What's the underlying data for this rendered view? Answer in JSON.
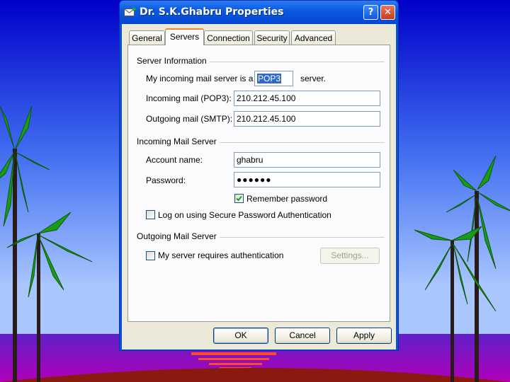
{
  "window": {
    "title": "Dr. S.K.Ghabru Properties",
    "help_label": "?",
    "close_label": "✕"
  },
  "tabs": [
    {
      "label": "General",
      "active": false
    },
    {
      "label": "Servers",
      "active": true
    },
    {
      "label": "Connection",
      "active": false
    },
    {
      "label": "Security",
      "active": false
    },
    {
      "label": "Advanced",
      "active": false
    }
  ],
  "server_info": {
    "group_label": "Server Information",
    "incoming_type_prefix": "My incoming mail server is a",
    "incoming_type_value": "POP3",
    "incoming_type_suffix": "server.",
    "incoming_label": "Incoming mail (POP3):",
    "incoming_value": "210.212.45.100",
    "outgoing_label": "Outgoing mail (SMTP):",
    "outgoing_value": "210.212.45.100"
  },
  "incoming_server": {
    "group_label": "Incoming Mail Server",
    "account_label": "Account name:",
    "account_value": "ghabru",
    "password_label": "Password:",
    "password_value": "●●●●●●",
    "remember_label": "Remember password",
    "remember_checked": true,
    "spa_label": "Log on using Secure Password Authentication",
    "spa_checked": false
  },
  "outgoing_server": {
    "group_label": "Outgoing Mail Server",
    "auth_label": "My server requires authentication",
    "auth_checked": false,
    "settings_label": "Settings..."
  },
  "buttons": {
    "ok": "OK",
    "cancel": "Cancel",
    "apply": "Apply"
  },
  "colors": {
    "desktop_sky_top": "#0000c8",
    "desktop_sky_bottom": "#8fb4ff",
    "sea": "#a000c0",
    "ground": "#8a1a10",
    "palm": "#1a9a1a",
    "window_accent": "#0a52d6"
  }
}
